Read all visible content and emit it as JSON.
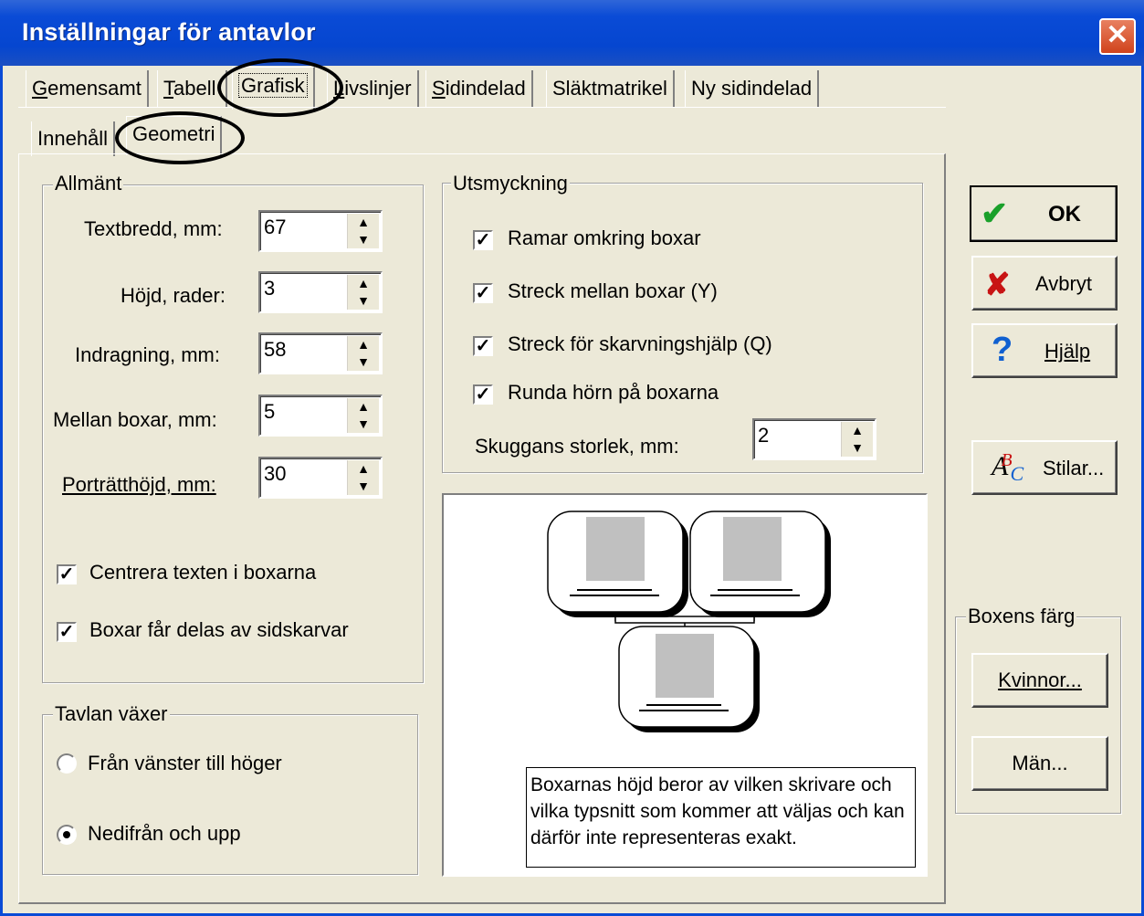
{
  "window": {
    "title": "Inställningar för antavlor",
    "close_label": "✕"
  },
  "tabs": [
    {
      "label": "Gemensamt",
      "u": "G",
      "rest": "emensamt"
    },
    {
      "label": "Tabell",
      "u": "T",
      "rest": "abell"
    },
    {
      "label": "Grafisk",
      "u": "",
      "rest": "Grafisk"
    },
    {
      "label": "Livslinjer",
      "u": "L",
      "rest": "ivslinjer"
    },
    {
      "label": "Sidindelad",
      "u": "S",
      "rest": "idindelad"
    },
    {
      "label": "Släktmatrikel",
      "u": "",
      "rest": "Släktmatrikel"
    },
    {
      "label": "Ny sidindelad",
      "u": "",
      "rest": "Ny sidindelad"
    }
  ],
  "subtabs": [
    {
      "label": "Innehåll"
    },
    {
      "label": "Geometri"
    }
  ],
  "allmant": {
    "legend": "Allmänt",
    "fields": [
      {
        "label": "Textbredd, mm:",
        "value": "67"
      },
      {
        "label": "Höjd, rader:",
        "value": "3"
      },
      {
        "label": "Indragning, mm:",
        "value": "58"
      },
      {
        "label": "Mellan boxar, mm:",
        "value": "5"
      },
      {
        "label": "Porträtthöjd, mm:",
        "value": "30"
      }
    ],
    "check_center": "Centrera texten i boxarna",
    "check_split": "Boxar får delas av sidskarvar"
  },
  "tavlan": {
    "legend": "Tavlan växer",
    "opt1": "Från vänster till höger",
    "opt2": "Nedifrån och upp"
  },
  "utsmyckning": {
    "legend": "Utsmyckning",
    "check1": "Ramar omkring boxar",
    "check2": "Streck mellan boxar (Y)",
    "check3": "Streck för skarvningshjälp (Q)",
    "check4": "Runda hörn på boxarna",
    "shadow_label": "Skuggans storlek, mm:",
    "shadow_value": "2"
  },
  "preview_note": "Boxarnas höjd beror av vilken skrivare och vilka typsnitt som kommer att väljas och kan därför inte representeras exakt.",
  "buttons": {
    "ok": "OK",
    "cancel": "Avbryt",
    "help": "Hjälp",
    "styles": "Stilar..."
  },
  "boxcolor": {
    "legend": "Boxens färg",
    "women": "Kvinnor...",
    "men": "Män..."
  },
  "colors": {
    "titlebar": "#0a4bd6",
    "face": "#ece9d8",
    "ok_check": "#1aa02a",
    "cancel_x": "#c81414",
    "help_q": "#1060d0"
  }
}
